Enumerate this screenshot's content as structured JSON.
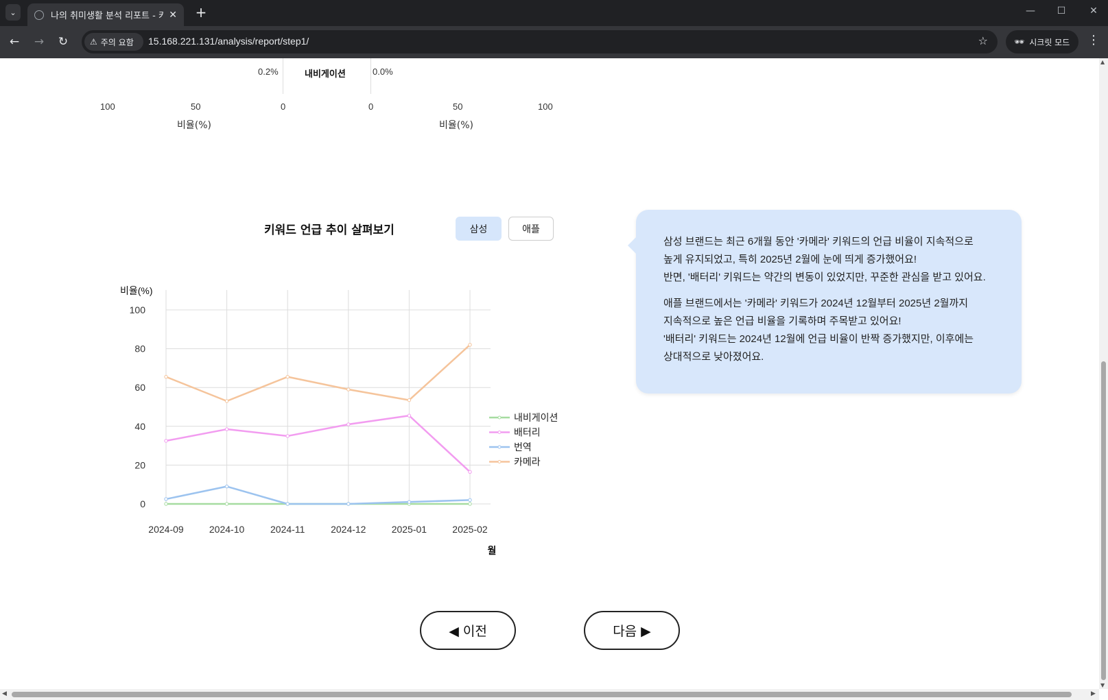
{
  "browser": {
    "tab_title": "나의 취미생활 분석 리포트 - 키",
    "security_label": "주의 요함",
    "url": "15.168.221.131/analysis/report/step1/",
    "incognito_label": "시크릿 모드"
  },
  "top_chart": {
    "left_value": "0.2%",
    "center_label": "내비게이션",
    "right_value": "0.0%",
    "left_ticks": [
      "100",
      "50",
      "0"
    ],
    "right_ticks": [
      "0",
      "50",
      "100"
    ],
    "left_axis_title": "비율(%)",
    "right_axis_title": "비율(%)"
  },
  "trend": {
    "title": "키워드 언급 추이 살펴보기",
    "brand_buttons": [
      "삼성",
      "애플"
    ],
    "selected_brand": "삼성"
  },
  "bubble": {
    "paragraph1": "삼성 브랜드는 최근 6개월 동안 '카메라' 키워드의 언급 비율이 지속적으로\n높게 유지되었고, 특히 2025년 2월에 눈에 띄게 증가했어요!\n반면, '배터리' 키워드는 약간의 변동이 있었지만, 꾸준한 관심을 받고 있어요.",
    "paragraph2": "애플 브랜드에서는 '카메라' 키워드가 2024년 12월부터 2025년 2월까지\n지속적으로 높은 언급 비율을 기록하며 주목받고 있어요!\n'배터리' 키워드는 2024년 12월에 언급 비율이 반짝 증가했지만, 이후에는\n상대적으로 낮아졌어요."
  },
  "pager": {
    "prev_label": "◀ 이전",
    "next_label": "다음 ▶"
  },
  "icons": [
    "tab-list-icon",
    "globe-icon",
    "close-icon",
    "plus-icon",
    "back-icon",
    "forward-icon",
    "reload-icon",
    "warning-icon",
    "star-icon",
    "incognito-icon",
    "more-icon"
  ],
  "chart_data": {
    "type": "line",
    "title": "키워드 언급 추이 살펴보기",
    "xlabel": "월",
    "ylabel": "비율(%)",
    "categories": [
      "2024-09",
      "2024-10",
      "2024-11",
      "2024-12",
      "2025-01",
      "2025-02"
    ],
    "ylim": [
      0,
      100
    ],
    "yticks": [
      0,
      20,
      40,
      60,
      80,
      100
    ],
    "grid": true,
    "legend_position": "right",
    "series": [
      {
        "name": "내비게이션",
        "color": "#a6dca0",
        "values": [
          0,
          0,
          0,
          0,
          0,
          0
        ]
      },
      {
        "name": "배터리",
        "color": "#f29cf0",
        "values": [
          32.5,
          38.5,
          35,
          41,
          45.5,
          16.5
        ]
      },
      {
        "name": "번역",
        "color": "#9cc3ef",
        "values": [
          2.5,
          9,
          0,
          0,
          1,
          2
        ]
      },
      {
        "name": "카메라",
        "color": "#f5c49b",
        "values": [
          65.5,
          53,
          65.5,
          59,
          53.5,
          82
        ]
      }
    ]
  }
}
